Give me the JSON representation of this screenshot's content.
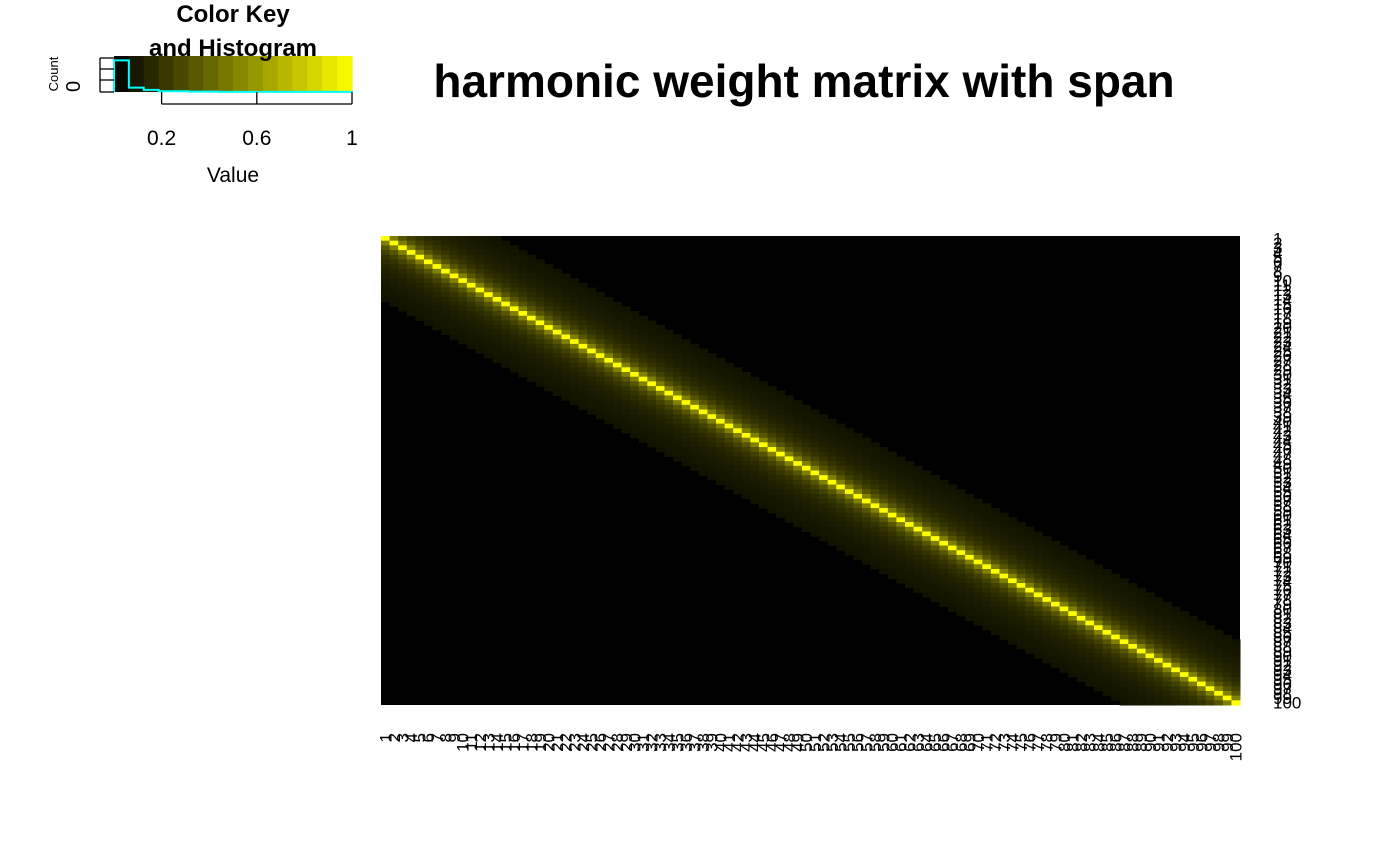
{
  "chart_data": {
    "type": "heatmap",
    "title": "harmonic weight matrix with span",
    "nrow": 100,
    "ncol": 100,
    "row_labels": [
      "1",
      "2",
      "3",
      "4",
      "5",
      "6",
      "7",
      "8",
      "9",
      "10",
      "11",
      "12",
      "13",
      "14",
      "15",
      "16",
      "17",
      "18",
      "19",
      "20",
      "21",
      "22",
      "23",
      "24",
      "25",
      "26",
      "27",
      "28",
      "29",
      "30",
      "31",
      "32",
      "33",
      "34",
      "35",
      "36",
      "37",
      "38",
      "39",
      "40",
      "41",
      "42",
      "43",
      "44",
      "45",
      "46",
      "47",
      "48",
      "49",
      "50",
      "51",
      "52",
      "53",
      "54",
      "55",
      "56",
      "57",
      "58",
      "59",
      "60",
      "61",
      "62",
      "63",
      "64",
      "65",
      "66",
      "67",
      "68",
      "69",
      "70",
      "71",
      "72",
      "73",
      "74",
      "75",
      "76",
      "77",
      "78",
      "79",
      "80",
      "81",
      "82",
      "83",
      "84",
      "85",
      "86",
      "87",
      "88",
      "89",
      "90",
      "91",
      "92",
      "93",
      "94",
      "95",
      "96",
      "97",
      "98",
      "99",
      "100"
    ],
    "col_labels": [
      "1",
      "2",
      "3",
      "4",
      "5",
      "6",
      "7",
      "8",
      "9",
      "10",
      "11",
      "12",
      "13",
      "14",
      "15",
      "16",
      "17",
      "18",
      "19",
      "20",
      "21",
      "22",
      "23",
      "24",
      "25",
      "26",
      "27",
      "28",
      "29",
      "30",
      "31",
      "32",
      "33",
      "34",
      "35",
      "36",
      "37",
      "38",
      "39",
      "40",
      "41",
      "42",
      "43",
      "44",
      "45",
      "46",
      "47",
      "48",
      "49",
      "50",
      "51",
      "52",
      "53",
      "54",
      "55",
      "56",
      "57",
      "58",
      "59",
      "60",
      "61",
      "62",
      "63",
      "64",
      "65",
      "66",
      "67",
      "68",
      "69",
      "70",
      "71",
      "72",
      "73",
      "74",
      "75",
      "76",
      "77",
      "78",
      "79",
      "80",
      "81",
      "82",
      "83",
      "84",
      "85",
      "86",
      "87",
      "88",
      "89",
      "90",
      "91",
      "92",
      "93",
      "94",
      "95",
      "96",
      "97",
      "98",
      "99",
      "100"
    ],
    "band_weights": [
      1,
      0.5,
      0.333,
      0.25,
      0.2,
      0.167,
      0.143,
      0.125,
      0.111,
      0.1,
      0.091,
      0.083,
      0.077,
      0.071
    ],
    "value_range": [
      0,
      1
    ],
    "colors": {
      "low": "#000000",
      "high": "#FFFF00",
      "histogram": "#00FFFF"
    },
    "color_key": {
      "title": "Color Key\nand Histogram",
      "xlabel": "Value",
      "ylabel": "Count",
      "ticks": [
        "0.2",
        "0.6",
        "1"
      ],
      "tick_values": [
        0.2,
        0.6,
        1
      ],
      "y_tick": "0",
      "bins": 16,
      "histogram": [
        0.88,
        0.12,
        0.06,
        0.02,
        0.02,
        0.01,
        0.01,
        0.005,
        0.005,
        0.005,
        0.005,
        0.005,
        0.005,
        0.005,
        0.005,
        0.005
      ]
    }
  }
}
